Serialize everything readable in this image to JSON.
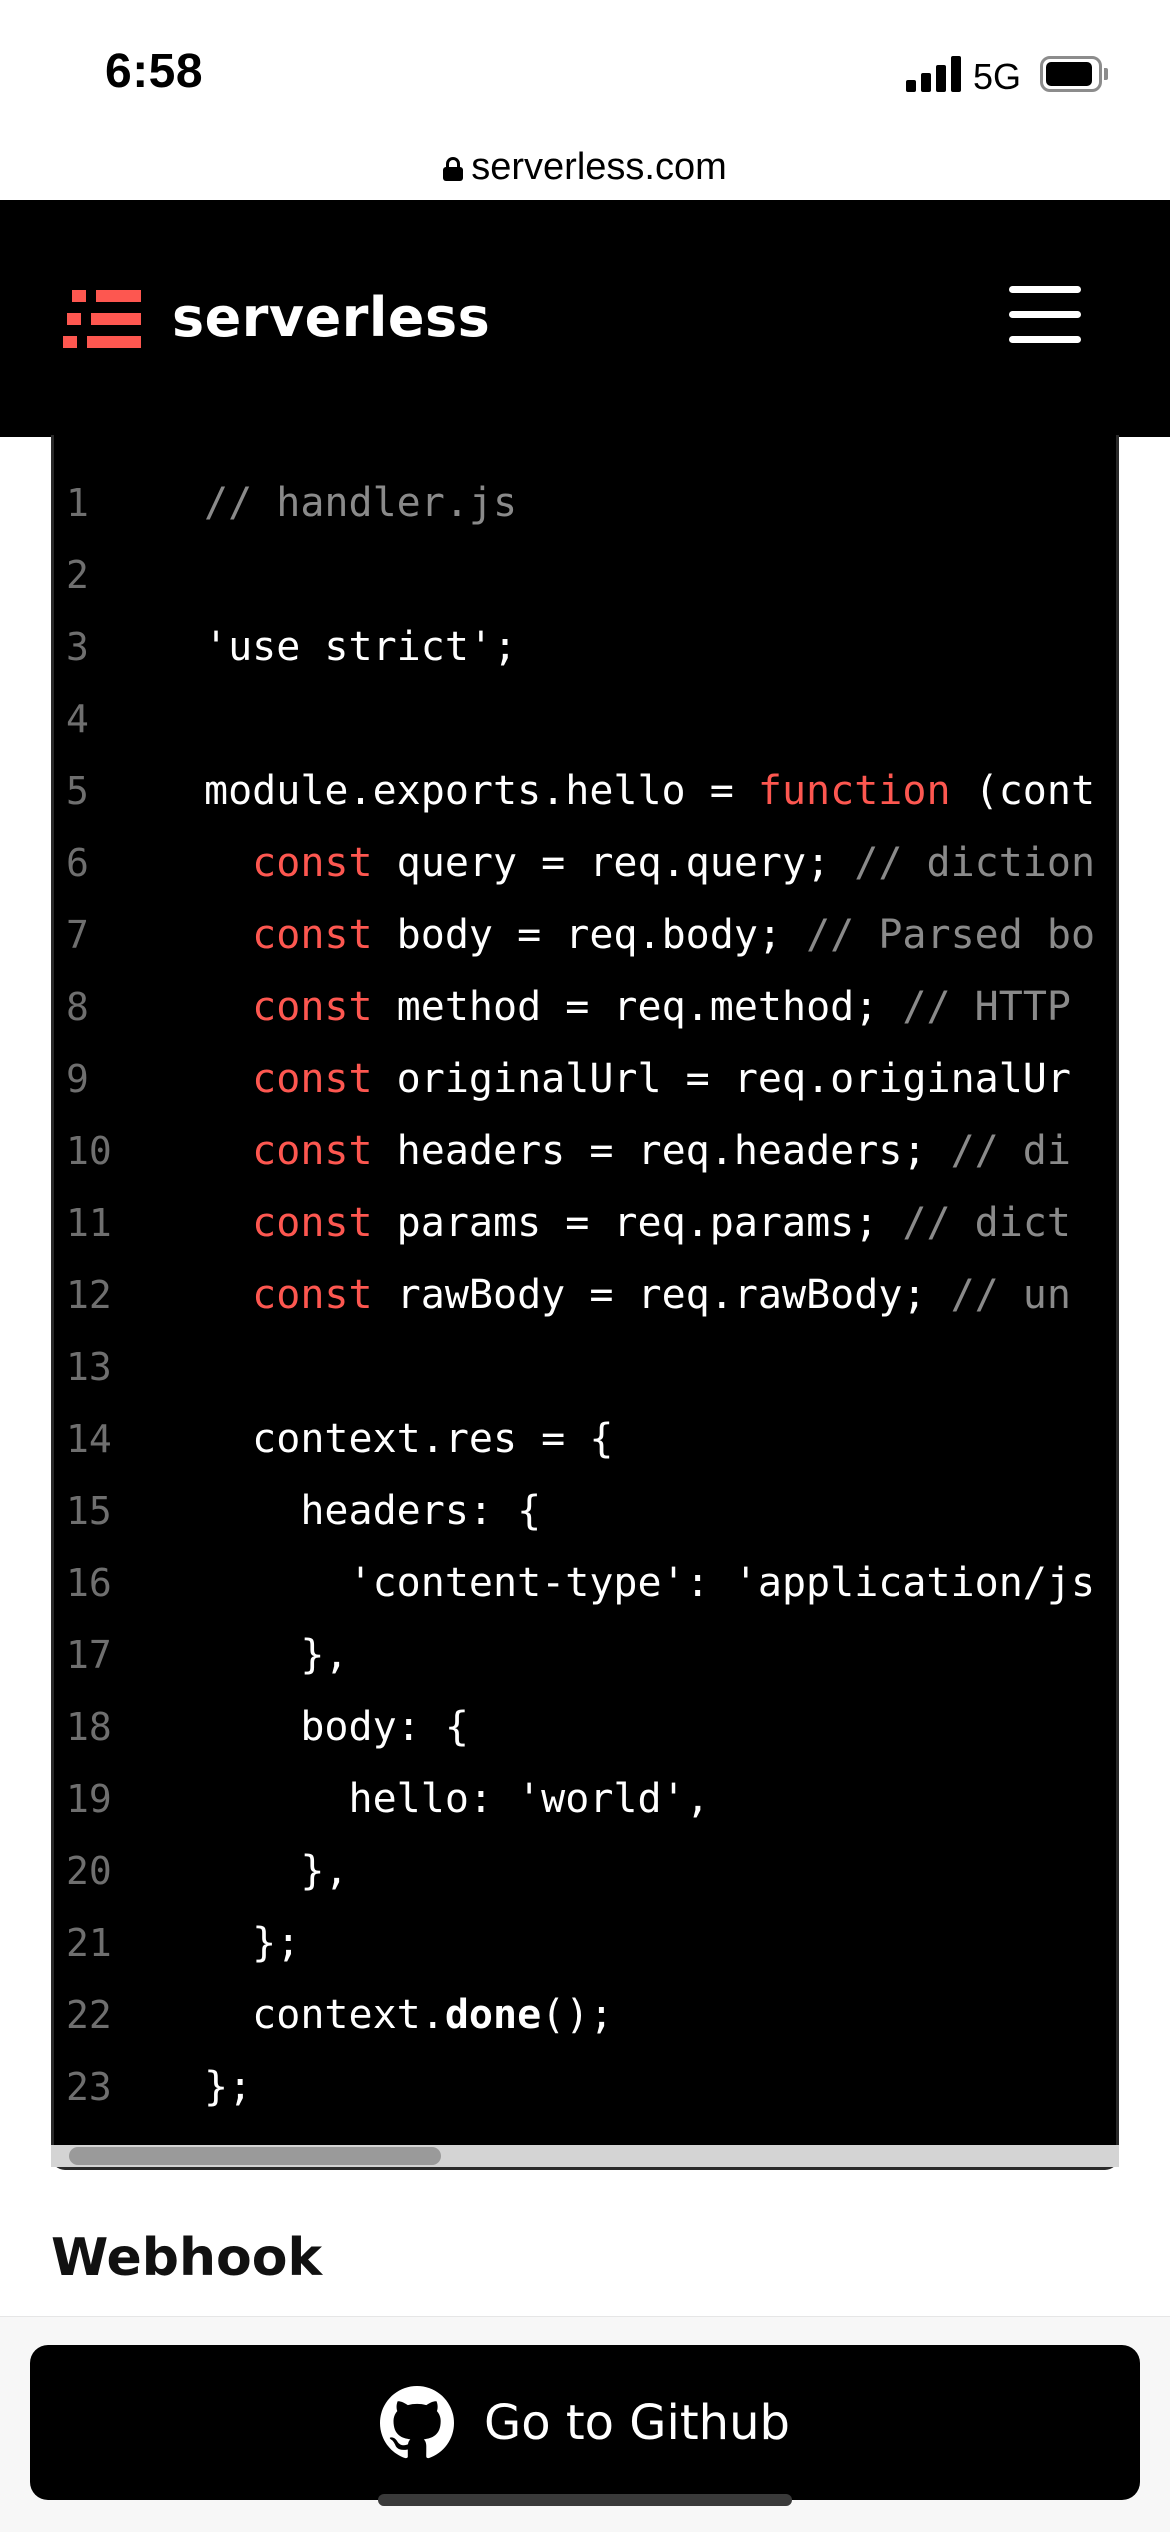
{
  "status_bar": {
    "time": "6:58",
    "network": "5G"
  },
  "browser": {
    "url": "serverless.com"
  },
  "header": {
    "brand": "serverless",
    "brand_color": "#fd5750"
  },
  "code": {
    "lines": [
      {
        "n": "1",
        "tokens": [
          {
            "t": "// handler.js",
            "c": "comment"
          }
        ]
      },
      {
        "n": "2",
        "tokens": []
      },
      {
        "n": "3",
        "tokens": [
          {
            "t": "'use strict';",
            "c": "plain"
          }
        ]
      },
      {
        "n": "4",
        "tokens": []
      },
      {
        "n": "5",
        "tokens": [
          {
            "t": "module.exports.hello = ",
            "c": "plain"
          },
          {
            "t": "function",
            "c": "keyword"
          },
          {
            "t": " (cont",
            "c": "plain"
          }
        ]
      },
      {
        "n": "6",
        "tokens": [
          {
            "t": "  ",
            "c": "plain"
          },
          {
            "t": "const",
            "c": "keyword"
          },
          {
            "t": " query = req.query; ",
            "c": "plain"
          },
          {
            "t": "// diction",
            "c": "comment"
          }
        ]
      },
      {
        "n": "7",
        "tokens": [
          {
            "t": "  ",
            "c": "plain"
          },
          {
            "t": "const",
            "c": "keyword"
          },
          {
            "t": " body = req.body; ",
            "c": "plain"
          },
          {
            "t": "// Parsed bo",
            "c": "comment"
          }
        ]
      },
      {
        "n": "8",
        "tokens": [
          {
            "t": "  ",
            "c": "plain"
          },
          {
            "t": "const",
            "c": "keyword"
          },
          {
            "t": " method = req.method; ",
            "c": "plain"
          },
          {
            "t": "// HTTP",
            "c": "comment"
          }
        ]
      },
      {
        "n": "9",
        "tokens": [
          {
            "t": "  ",
            "c": "plain"
          },
          {
            "t": "const",
            "c": "keyword"
          },
          {
            "t": " originalUrl = req.originalUr",
            "c": "plain"
          }
        ]
      },
      {
        "n": "10",
        "tokens": [
          {
            "t": "  ",
            "c": "plain"
          },
          {
            "t": "const",
            "c": "keyword"
          },
          {
            "t": " headers = req.headers; ",
            "c": "plain"
          },
          {
            "t": "// di",
            "c": "comment"
          }
        ]
      },
      {
        "n": "11",
        "tokens": [
          {
            "t": "  ",
            "c": "plain"
          },
          {
            "t": "const",
            "c": "keyword"
          },
          {
            "t": " params = req.params; ",
            "c": "plain"
          },
          {
            "t": "// dict",
            "c": "comment"
          }
        ]
      },
      {
        "n": "12",
        "tokens": [
          {
            "t": "  ",
            "c": "plain"
          },
          {
            "t": "const",
            "c": "keyword"
          },
          {
            "t": " rawBody = req.rawBody; ",
            "c": "plain"
          },
          {
            "t": "// un",
            "c": "comment"
          }
        ]
      },
      {
        "n": "13",
        "tokens": []
      },
      {
        "n": "14",
        "tokens": [
          {
            "t": "  context.res = {",
            "c": "plain"
          }
        ]
      },
      {
        "n": "15",
        "tokens": [
          {
            "t": "    headers: {",
            "c": "plain"
          }
        ]
      },
      {
        "n": "16",
        "tokens": [
          {
            "t": "      'content-type': 'application/js",
            "c": "plain"
          }
        ]
      },
      {
        "n": "17",
        "tokens": [
          {
            "t": "    },",
            "c": "plain"
          }
        ]
      },
      {
        "n": "18",
        "tokens": [
          {
            "t": "    body: {",
            "c": "plain"
          }
        ]
      },
      {
        "n": "19",
        "tokens": [
          {
            "t": "      hello: 'world',",
            "c": "plain"
          }
        ]
      },
      {
        "n": "20",
        "tokens": [
          {
            "t": "    },",
            "c": "plain"
          }
        ]
      },
      {
        "n": "21",
        "tokens": [
          {
            "t": "  };",
            "c": "plain"
          }
        ]
      },
      {
        "n": "22",
        "tokens": [
          {
            "t": "  context.",
            "c": "plain"
          },
          {
            "t": "done",
            "c": "bold"
          },
          {
            "t": "();",
            "c": "plain"
          }
        ]
      },
      {
        "n": "23",
        "tokens": [
          {
            "t": "};",
            "c": "plain"
          }
        ]
      }
    ]
  },
  "section": {
    "heading": "Webhook"
  },
  "cta": {
    "label": "Go to Github"
  }
}
